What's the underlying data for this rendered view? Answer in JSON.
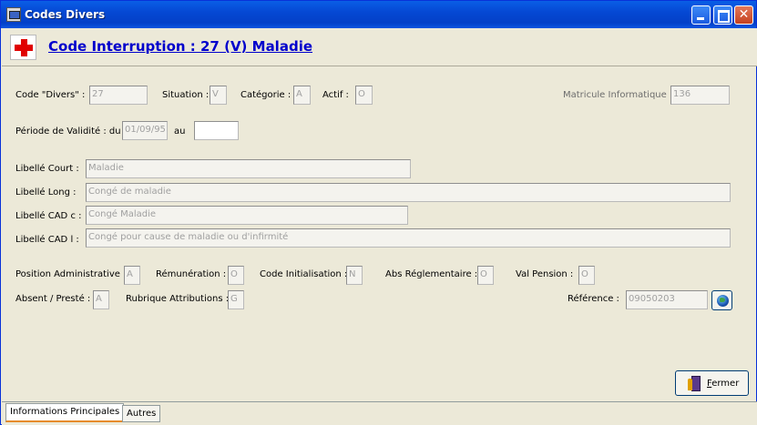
{
  "window": {
    "title": "Codes Divers",
    "controls": {
      "minimize": "minimize",
      "maximize": "maximize",
      "close": "✕"
    }
  },
  "header": {
    "title": "Code Interruption : 27 (V) Maladie",
    "logo_icon": "red-cross-icon",
    "logo_color": "#e00000"
  },
  "form": {
    "code_divers": {
      "label": "Code \"Divers\" :",
      "value": "27"
    },
    "situation": {
      "label": "Situation :",
      "value": "V"
    },
    "categorie": {
      "label": "Catégorie :",
      "value": "A"
    },
    "actif": {
      "label": "Actif :",
      "value": "O"
    },
    "matricule": {
      "label": "Matricule Informatique :",
      "value": "136"
    },
    "periode": {
      "label": "Période de Validité : du",
      "from": "01/09/95",
      "to_label": "au",
      "to": ""
    },
    "libelle_court": {
      "label": "Libellé Court :",
      "value": "Maladie"
    },
    "libelle_long": {
      "label": "Libellé Long :",
      "value": "Congé de maladie"
    },
    "libelle_cad_c": {
      "label": "Libellé CAD c :",
      "value": "Congé Maladie"
    },
    "libelle_cad_l": {
      "label": "Libellé CAD l :",
      "value": "Congé pour cause de maladie ou d'infirmité"
    },
    "position_admin": {
      "label": "Position Administrative :",
      "value": "A"
    },
    "remuneration": {
      "label": "Rémunération :",
      "value": "O"
    },
    "code_init": {
      "label": "Code Initialisation :",
      "value": "N"
    },
    "abs_regl": {
      "label": "Abs Réglementaire :",
      "value": "O"
    },
    "val_pension": {
      "label": "Val Pension :",
      "value": "O"
    },
    "absent_preste": {
      "label": "Absent / Presté :",
      "value": "A"
    },
    "rubrique_attr": {
      "label": "Rubrique Attributions :",
      "value": "G"
    },
    "reference": {
      "label": "Référence :",
      "value": "09050203"
    }
  },
  "buttons": {
    "globe_icon": "globe-icon",
    "fermer_prefix": "F",
    "fermer_rest": "ermer",
    "fermer_icon": "exit-door-icon"
  },
  "tabs": [
    {
      "label": "Informations Principales",
      "active": true
    },
    {
      "label": "Autres",
      "active": false
    }
  ],
  "colors": {
    "title_bar": "#0548d4",
    "header_title": "#0000cc",
    "tab_accent": "#e68b2c"
  }
}
